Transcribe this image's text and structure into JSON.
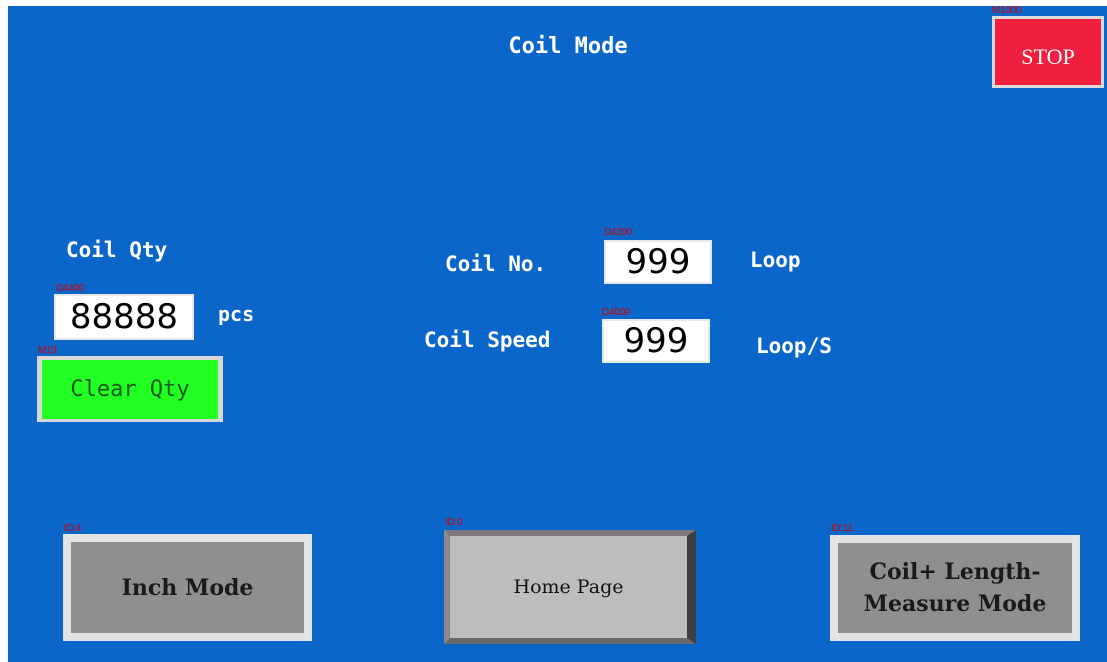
{
  "screen": {
    "title": "Coil Mode"
  },
  "stop_button": {
    "address": "M1000",
    "label": "STOP"
  },
  "coil_qty": {
    "label": "Coil Qty",
    "address": "D4400",
    "value": "88888",
    "unit": "pcs"
  },
  "clear_qty_button": {
    "address": "M19",
    "label": "Clear Qty"
  },
  "coil_no": {
    "label": "Coil No.",
    "address": "D4200",
    "value": "999",
    "unit": "Loop"
  },
  "coil_speed": {
    "label": "Coil Speed",
    "address": "D4000",
    "value": "999",
    "unit": "Loop/S"
  },
  "nav": {
    "inch_mode": {
      "address": "ID:4",
      "label": "Inch Mode"
    },
    "home_page": {
      "address": "ID:0",
      "label": "Home Page"
    },
    "coil_length": {
      "address": "ID:11",
      "label_line1": "Coil+ Length-",
      "label_line2": "Measure Mode"
    }
  },
  "colors": {
    "background": "#0a66c8",
    "stop": "#ee1f3f",
    "clear_qty": "#22ff22",
    "address_text": "#d40000"
  }
}
